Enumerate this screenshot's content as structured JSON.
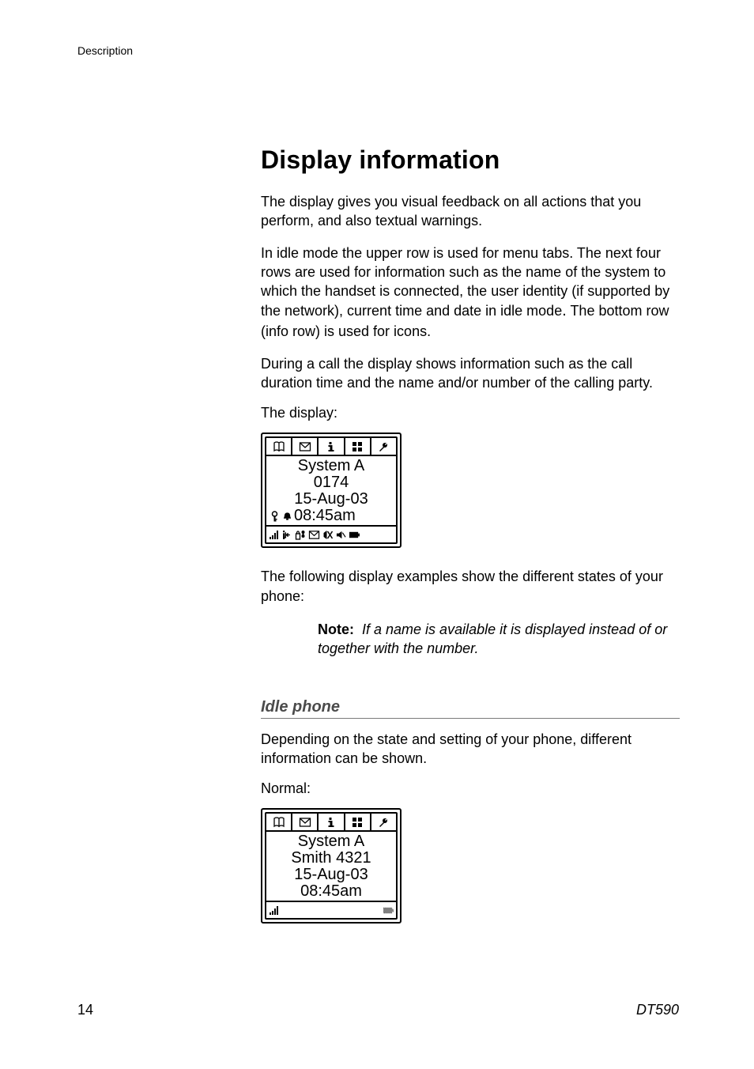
{
  "header": {
    "section": "Description"
  },
  "title": "Display information",
  "paragraphs": {
    "p1": "The display gives you visual feedback on all actions that you perform, and also textual warnings.",
    "p2a": "In idle mode the upper row is used for menu tabs. The next four rows are used for information such as the name of the system to which the handset is connected, the user identity (if supported by the network), current time and date in idle mode",
    "p2b": " The bottom row (info row) is used for icons.",
    "p3": "During a call the display shows information such as the call duration time and the name and/or number of the calling party.",
    "display_label": "The display:",
    "p4": "The following display examples show the different states of your phone:",
    "idle_intro": "Depending on the state and setting of your phone, different information can be shown.",
    "normal_label": "Normal:"
  },
  "note": {
    "label": "Note:",
    "body": "If a name is available it is displayed instead of or together with the number."
  },
  "subheading": "Idle phone",
  "display1": {
    "line1": "System A",
    "line2": "0174",
    "line3": "15-Aug-03",
    "line4": "08:45am"
  },
  "display2": {
    "line1": "System A",
    "line2": "Smith  4321",
    "line3": "15-Aug-03",
    "line4": "08:45am"
  },
  "footer": {
    "page": "14",
    "model": "DT590"
  }
}
